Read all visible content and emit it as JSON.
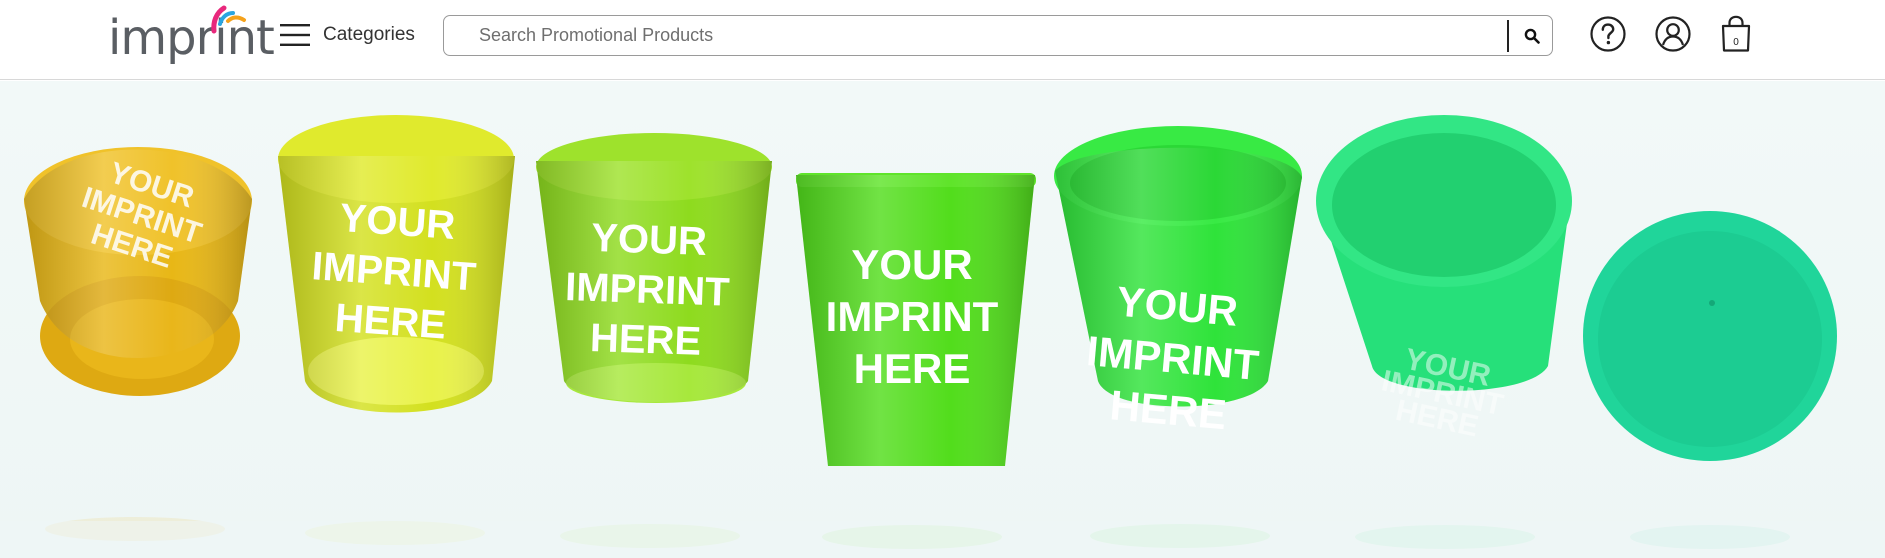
{
  "header": {
    "logo_text": "imprint",
    "categories_label": "Categories",
    "search": {
      "placeholder": "Search Promotional Products",
      "value": ""
    },
    "icons": {
      "menu": "hamburger-icon",
      "search": "search-icon",
      "help": "help-circle-icon",
      "account": "user-account-icon",
      "cart": "shopping-bag-icon"
    },
    "cart_count": "0"
  },
  "hero": {
    "cup_lines": [
      "YOUR",
      "IMPRINT",
      "HERE"
    ],
    "cup_colors": [
      "#e8b716",
      "#d3e01f",
      "#8edb1e",
      "#52dd1c",
      "#2fe33a",
      "#26e07a",
      "#20d59a"
    ]
  }
}
